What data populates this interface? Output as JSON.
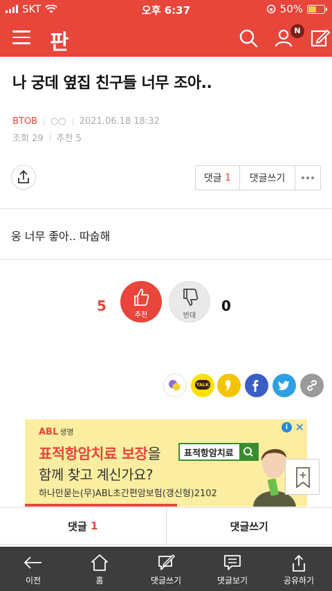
{
  "status_bar": {
    "carrier": "SKT",
    "time": "오후 6:37",
    "battery": "50%"
  },
  "header": {
    "logo": "판",
    "notification_badge": "N"
  },
  "post": {
    "title": "나 궁데 옆집 친구들 너무 조아..",
    "author": "BTOB",
    "author_extra": "○○",
    "date": "2021.06.18 18:32",
    "views_label": "조회 29",
    "recommend_label": "추천 5",
    "content": "웅 너무 좋아.. 따숩해"
  },
  "actions": {
    "comment_label": "댓글",
    "comment_count": "1",
    "write_comment": "댓글쓰기"
  },
  "votes": {
    "up_count": "5",
    "up_label": "추천",
    "down_count": "0",
    "down_label": "반대"
  },
  "share_icons": [
    "kakao-story-icon",
    "kakao-talk-icon",
    "band-icon",
    "facebook-icon",
    "twitter-icon",
    "link-icon"
  ],
  "share_talk_label": "TALK",
  "ad": {
    "brand": "ABL",
    "brand_suffix": "생명",
    "line1_highlight": "표적항암치료 보장",
    "line1_rest": "을",
    "line2": "함께 찾고 계신가요?",
    "search_text": "표적항암치료",
    "line3": "하나만묻는(무)ABL초간편암보험(갱신형)2102"
  },
  "comment_bar": {
    "comment_label": "댓글",
    "comment_count": "1",
    "write_label": "댓글쓰기"
  },
  "bottom_nav": [
    {
      "label": "이전",
      "icon": "back-arrow-icon"
    },
    {
      "label": "홈",
      "icon": "home-icon"
    },
    {
      "label": "댓글쓰기",
      "icon": "write-comment-icon"
    },
    {
      "label": "댓글보기",
      "icon": "view-comments-icon"
    },
    {
      "label": "공유하기",
      "icon": "share-icon"
    }
  ],
  "colors": {
    "brand": "#e8453b",
    "nav_bg": "#3d3d3d",
    "ad_bg": "#fbeea0"
  }
}
